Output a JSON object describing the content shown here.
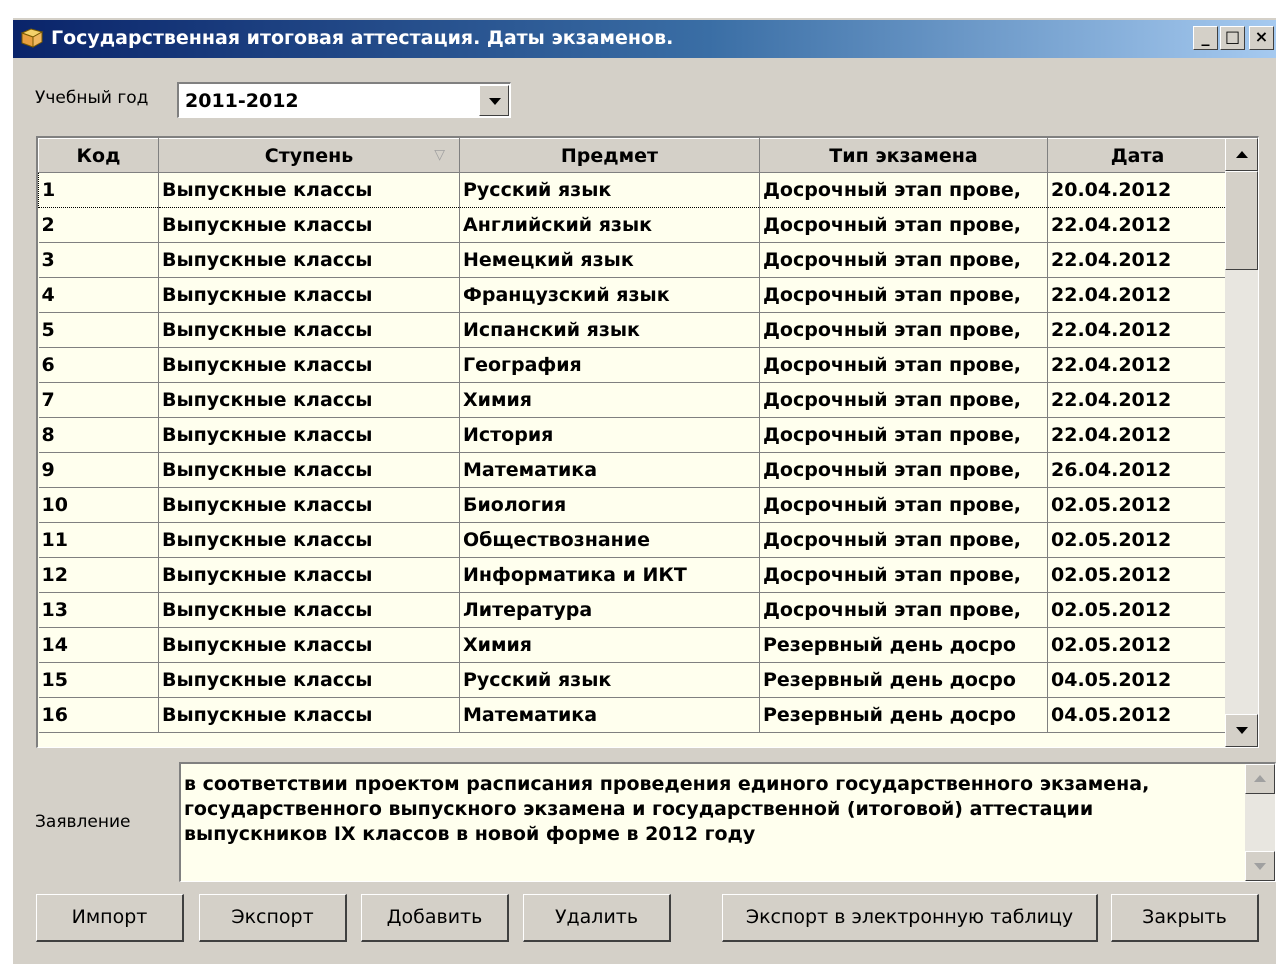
{
  "window": {
    "title": "Государственная итоговая аттестация. Даты экзаменов.",
    "controls": {
      "minimize": "_",
      "maximize": "□",
      "close": "×"
    }
  },
  "year": {
    "label": "Учебный год",
    "value": "2011-2012"
  },
  "grid": {
    "columns": [
      "Код",
      "Ступень",
      "Предмет",
      "Тип экзамена",
      "Дата"
    ],
    "sort_indicator": "▽",
    "rows": [
      [
        "1",
        "Выпускные классы",
        "Русский язык",
        "Досрочный этап прове,",
        "20.04.2012"
      ],
      [
        "2",
        "Выпускные классы",
        "Английский язык",
        "Досрочный этап прове,",
        "22.04.2012"
      ],
      [
        "3",
        "Выпускные классы",
        "Немецкий язык",
        "Досрочный этап прове,",
        "22.04.2012"
      ],
      [
        "4",
        "Выпускные классы",
        "Французский язык",
        "Досрочный этап прове,",
        "22.04.2012"
      ],
      [
        "5",
        "Выпускные классы",
        "Испанский язык",
        "Досрочный этап прове,",
        "22.04.2012"
      ],
      [
        "6",
        "Выпускные классы",
        "География",
        "Досрочный этап прове,",
        "22.04.2012"
      ],
      [
        "7",
        "Выпускные классы",
        "Химия",
        "Досрочный этап прове,",
        "22.04.2012"
      ],
      [
        "8",
        "Выпускные классы",
        "История",
        "Досрочный этап прове,",
        "22.04.2012"
      ],
      [
        "9",
        "Выпускные классы",
        "Математика",
        "Досрочный этап прове,",
        "26.04.2012"
      ],
      [
        "10",
        "Выпускные классы",
        "Биология",
        "Досрочный этап прове,",
        "02.05.2012"
      ],
      [
        "11",
        "Выпускные классы",
        "Обществознание",
        "Досрочный этап прове,",
        "02.05.2012"
      ],
      [
        "12",
        "Выпускные классы",
        "Информатика и ИКТ",
        "Досрочный этап прове,",
        "02.05.2012"
      ],
      [
        "13",
        "Выпускные классы",
        "Литература",
        "Досрочный этап прове,",
        "02.05.2012"
      ],
      [
        "14",
        "Выпускные классы",
        "Химия",
        "Резервный день досро",
        "02.05.2012"
      ],
      [
        "15",
        "Выпускные классы",
        "Русский язык",
        "Резервный день досро",
        "04.05.2012"
      ],
      [
        "16",
        "Выпускные классы",
        "Математика",
        "Резервный день досро",
        "04.05.2012"
      ]
    ],
    "selected_row": 0
  },
  "statement": {
    "label": "Заявление",
    "text": "в соответствии проектом расписания проведения единого государственного экзамена,\nгосударственного выпускного экзамена и государственной (итоговой) аттестации\nвыпускников IX классов в новой форме в 2012 году"
  },
  "buttons": {
    "import": "Импорт",
    "export": "Экспорт",
    "add": "Добавить",
    "delete": "Удалить",
    "export_sheet": "Экспорт в электронную таблицу",
    "close": "Закрыть"
  },
  "colors": {
    "titlebar_start": "#0a246a",
    "titlebar_end": "#a6caf0",
    "grid_bg": "#ffffee",
    "face": "#d4d0c8"
  }
}
